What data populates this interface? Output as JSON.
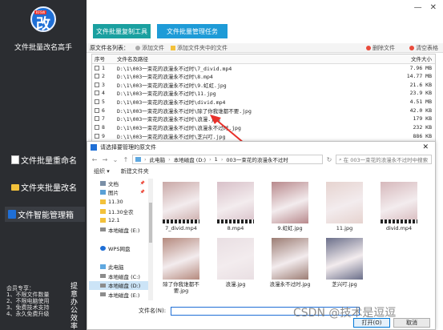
{
  "sidebar": {
    "logo_tag": "KFSW",
    "logo_char": "改",
    "app_title": "文件批量改名高手",
    "nav": [
      {
        "label": "文件批量重命名",
        "icon": "document-icon"
      },
      {
        "label": "文件夹批量改名",
        "icon": "folder-icon"
      },
      {
        "label": "文件智能管理箱",
        "icon": "manager-icon"
      }
    ],
    "footer_lines": [
      "会员专享：",
      "1、不限文件数量",
      "2、不限电脑使用",
      "3、免费技术支持",
      "4、永久免费升级"
    ],
    "vertical_text": "提意办公效率"
  },
  "topbar": {
    "btn_copy": "文件批量复制工具",
    "btn_manage": "文件批量管理任务",
    "min": "—",
    "close": "✕"
  },
  "toolbar": {
    "label": "原文件名列表：",
    "add_file": "添加文件",
    "add_folder": "添加文件夹中的文件",
    "delete": "删除文件",
    "clear": "清空表格"
  },
  "file_table": {
    "headers": [
      "序号",
      "文件名及路径",
      "文件大小"
    ],
    "rows": [
      {
        "n": "1",
        "path": "D:\\1\\003一束花的浪漫永不过时\\7_divid.mp4",
        "size": "7.96 MB"
      },
      {
        "n": "2",
        "path": "D:\\1\\003一束花的浪漫永不过时\\8.mp4",
        "size": "14.77 MB"
      },
      {
        "n": "3",
        "path": "D:\\1\\003一束花的浪漫永不过时\\9.虹虹.jpg",
        "size": "21.6 KB"
      },
      {
        "n": "4",
        "path": "D:\\1\\003一束花的浪漫永不过时\\11.jpg",
        "size": "23.9 KB"
      },
      {
        "n": "5",
        "path": "D:\\1\\003一束花的浪漫永不过时\\divid.mp4",
        "size": "4.51 MB"
      },
      {
        "n": "6",
        "path": "D:\\1\\003一束花的浪漫永不过时\\除了你我谁都不要.jpg",
        "size": "42.0 KB"
      },
      {
        "n": "7",
        "path": "D:\\1\\003一束花的浪漫永不过时\\浪漫.jpg",
        "size": "179 KB"
      },
      {
        "n": "8",
        "path": "D:\\1\\003一束花的浪漫永不过时\\浪漫永不过时.jpg",
        "size": "232 KB"
      },
      {
        "n": "9",
        "path": "D:\\1\\003一束花的浪漫永不过时\\芝兴叮.jpg",
        "size": "886 KB"
      }
    ]
  },
  "dialog": {
    "title": "请选择要管理的原文件",
    "close": "✕",
    "breadcrumb": [
      "此电脑",
      "本地磁盘 (D:)",
      "1",
      "003一束花的浪漫永不过时"
    ],
    "search_placeholder": "在 003一束花的浪漫永不过时中搜索",
    "organize": "组织 ▾",
    "new_folder": "新建文件夹",
    "tree": [
      {
        "label": "文档",
        "icon": "document-icon",
        "pin": "📌"
      },
      {
        "label": "图片",
        "icon": "picture-icon",
        "pin": "📌"
      },
      {
        "label": "11.30",
        "icon": "folder-icon",
        "pin": ""
      },
      {
        "label": "11.30全农",
        "icon": "folder-icon",
        "pin": ""
      },
      {
        "label": "12.1",
        "icon": "folder-icon",
        "pin": ""
      },
      {
        "label": "本地磁盘 (E:)",
        "icon": "disk-icon",
        "pin": ""
      },
      {
        "label": "",
        "icon": "",
        "pin": ""
      },
      {
        "label": "WPS网盘",
        "icon": "cloud-icon",
        "pin": ""
      },
      {
        "label": "",
        "icon": "",
        "pin": ""
      },
      {
        "label": "此电脑",
        "icon": "computer-icon",
        "pin": ""
      },
      {
        "label": "本地磁盘 (C:)",
        "icon": "disk-icon",
        "pin": ""
      },
      {
        "label": "本地磁盘 (D:)",
        "icon": "disk-icon",
        "pin": ""
      },
      {
        "label": "本地磁盘 (E:)",
        "icon": "disk-icon",
        "pin": ""
      }
    ],
    "files": [
      {
        "name": "7_divid.mp4",
        "color": "#c9a8a6",
        "video": true
      },
      {
        "name": "8.mp4",
        "color": "#d8c0c8",
        "video": true
      },
      {
        "name": "9.虹虹.jpg",
        "color": "#b8898c",
        "video": false
      },
      {
        "name": "11.jpg",
        "color": "#e6d3cf",
        "video": false
      },
      {
        "name": "divid.mp4",
        "color": "#d6b8bb",
        "video": true
      },
      {
        "name": "除了你我谁都不要.jpg",
        "color": "#b58a7e",
        "video": false
      },
      {
        "name": "浪漫.jpg",
        "color": "#e9dfe3",
        "video": false
      },
      {
        "name": "浪漫永不过时.jpg",
        "color": "#9c7d74",
        "video": false
      },
      {
        "name": "芝兴叮.jpg",
        "color": "#6b6f8a",
        "video": false
      }
    ],
    "filename_label": "文件名(N):",
    "open_btn": "打开(O)",
    "cancel_btn": "取消"
  },
  "watermark": "CSDN @技术是逗逗"
}
